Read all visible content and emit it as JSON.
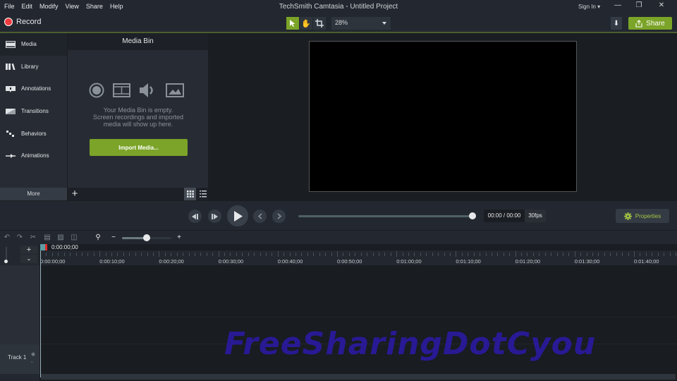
{
  "window": {
    "title": "TechSmith Camtasia - Untitled Project",
    "menu": [
      "File",
      "Edit",
      "Modify",
      "View",
      "Share",
      "Help"
    ],
    "sign_in": "Sign In",
    "controls": {
      "minimize": "—",
      "restore": "❐",
      "close": "✕"
    }
  },
  "toolbar": {
    "record_label": "Record",
    "zoom_level": "28%",
    "share_label": "Share",
    "tools": [
      "select-tool",
      "pan-tool",
      "crop-tool"
    ]
  },
  "sidebar": {
    "items": [
      {
        "label": "Media",
        "icon": "film-icon",
        "active": true
      },
      {
        "label": "Library",
        "icon": "library-icon"
      },
      {
        "label": "Annotations",
        "icon": "annotation-icon"
      },
      {
        "label": "Transitions",
        "icon": "transition-icon"
      },
      {
        "label": "Behaviors",
        "icon": "behaviors-icon"
      },
      {
        "label": "Animations",
        "icon": "animation-icon"
      }
    ],
    "more_label": "More"
  },
  "media_bin": {
    "title": "Media Bin",
    "empty_line1": "Your Media Bin is empty.",
    "empty_line2": "Screen recordings and imported",
    "empty_line3": "media will show up here.",
    "import_label": "Import Media...",
    "add_label": "+"
  },
  "playback": {
    "time": "00:00 / 00:00",
    "fps": "30fps",
    "properties_label": "Properties",
    "progress": 1.0
  },
  "timeline": {
    "playhead_time": "0:00:00;00",
    "zoom_fraction": 0.5,
    "ruler_labels": [
      "0:00:00;00",
      "0:00:10;00",
      "0:00:20;00",
      "0:00:30;00",
      "0:00:40;00",
      "0:00:50;00",
      "0:01:00;00",
      "0:01:10;00",
      "0:01:20;00",
      "0:01:30;00",
      "0:01:40;00"
    ],
    "tracks": [
      {
        "label": "Track 1"
      }
    ]
  },
  "colors": {
    "accent": "#7ba428",
    "record": "#ee3b40",
    "background": "#1a1d22",
    "panel": "#272c34"
  },
  "watermark": "FreeSharingDotCyou"
}
